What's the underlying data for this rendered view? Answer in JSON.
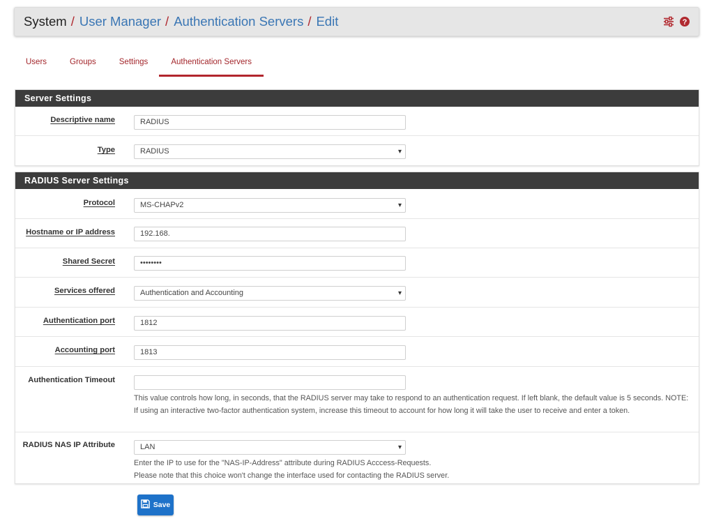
{
  "breadcrumb": {
    "root": "System",
    "items": [
      "User Manager",
      "Authentication Servers",
      "Edit"
    ],
    "separator": "/"
  },
  "header_icons": [
    "sliders-icon",
    "help-icon"
  ],
  "tabs": [
    "Users",
    "Groups",
    "Settings",
    "Authentication Servers"
  ],
  "active_tab": "Authentication Servers",
  "server_settings": {
    "heading": "Server Settings",
    "descriptive_name_label": "Descriptive name",
    "descriptive_name_value": "RADIUS",
    "type_label": "Type",
    "type_value": "RADIUS"
  },
  "radius_settings": {
    "heading": "RADIUS Server Settings",
    "protocol_label": "Protocol",
    "protocol_value": "MS-CHAPv2",
    "hostname_label": "Hostname or IP address",
    "hostname_value": "192.168.",
    "secret_label": "Shared Secret",
    "secret_value": "••••••••",
    "services_label": "Services offered",
    "services_value": "Authentication and Accounting",
    "auth_port_label": "Authentication port",
    "auth_port_value": "1812",
    "acct_port_label": "Accounting port",
    "acct_port_value": "1813",
    "timeout_label": "Authentication Timeout",
    "timeout_value": "",
    "timeout_help": "This value controls how long, in seconds, that the RADIUS server may take to respond to an authentication request. If left blank, the default value is 5 seconds. NOTE: If using an interactive two-factor authentication system, increase this timeout to account for how long it will take the user to receive and enter a token.",
    "nas_ip_label": "RADIUS NAS IP Attribute",
    "nas_ip_value": "LAN",
    "nas_ip_help_1": "Enter the IP to use for the \"NAS-IP-Address\" attribute during RADIUS Acccess-Requests.",
    "nas_ip_help_2": "Please note that this choice won't change the interface used for contacting the RADIUS server."
  },
  "save_label": "Save",
  "colors": {
    "link": "#3a76b4",
    "accent_red": "#b2262d",
    "panel_heading": "#3c3c3c",
    "save_button": "#1e72c9"
  }
}
